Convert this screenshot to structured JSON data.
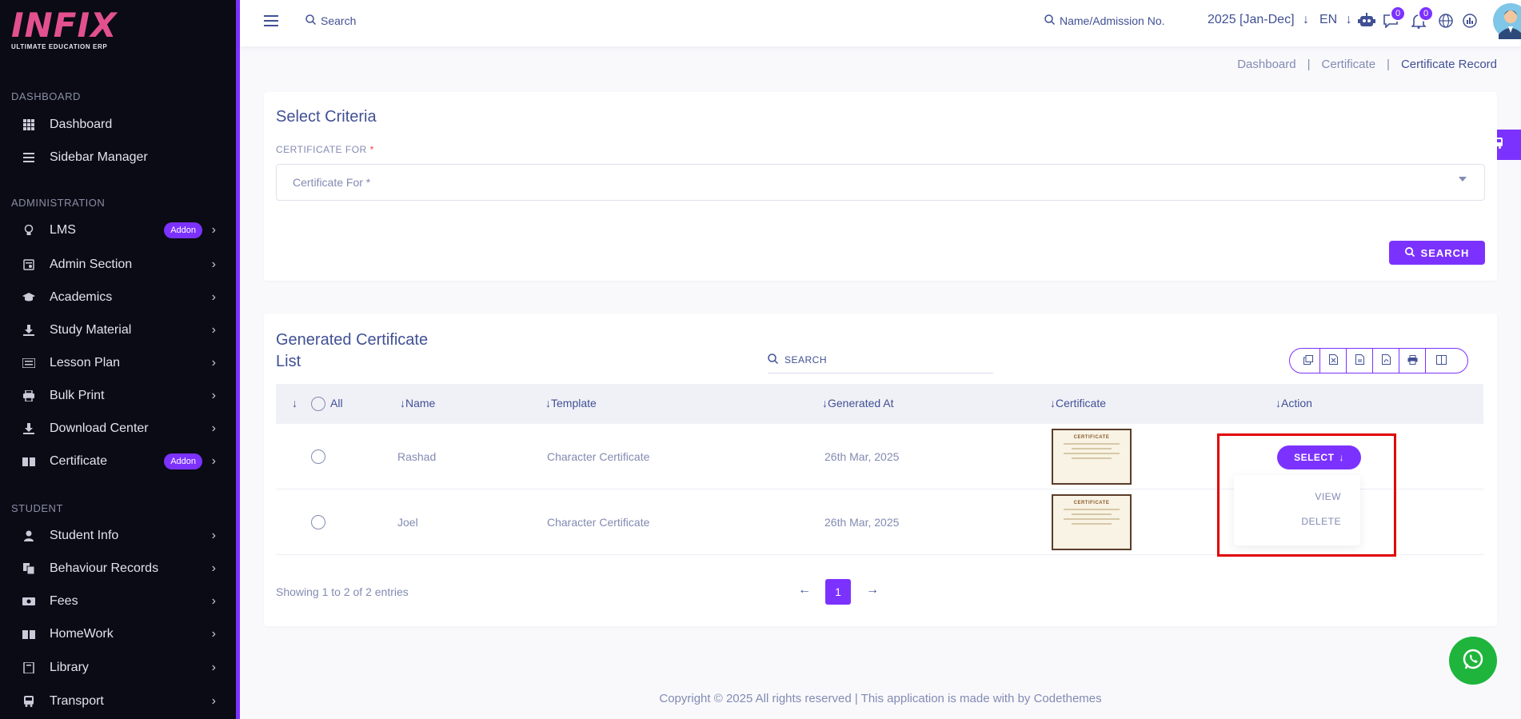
{
  "app": {
    "logo_text": "INFIX",
    "logo_sub": "ULTIMATE EDUCATION ERP"
  },
  "sidebar": {
    "sections": {
      "dashboard": "DASHBOARD",
      "administration": "ADMINISTRATION",
      "student": "STUDENT"
    },
    "items": [
      {
        "label": "Dashboard",
        "icon": "grid-icon"
      },
      {
        "label": "Sidebar Manager",
        "icon": "list-icon"
      },
      {
        "label": "LMS",
        "icon": "bulb-icon",
        "badge": "Addon"
      },
      {
        "label": "Admin Section",
        "icon": "admin-icon"
      },
      {
        "label": "Academics",
        "icon": "graduation-cap-icon"
      },
      {
        "label": "Study Material",
        "icon": "download-icon"
      },
      {
        "label": "Lesson Plan",
        "icon": "book-open-icon"
      },
      {
        "label": "Bulk Print",
        "icon": "printer-icon"
      },
      {
        "label": "Download Center",
        "icon": "download-icon"
      },
      {
        "label": "Certificate",
        "icon": "certificate-icon",
        "badge": "Addon"
      },
      {
        "label": "Student Info",
        "icon": "user-icon"
      },
      {
        "label": "Behaviour Records",
        "icon": "records-icon"
      },
      {
        "label": "Fees",
        "icon": "money-icon"
      },
      {
        "label": "HomeWork",
        "icon": "book-icon"
      },
      {
        "label": "Library",
        "icon": "library-icon"
      },
      {
        "label": "Transport",
        "icon": "bus-icon"
      }
    ]
  },
  "topbar": {
    "search_label": "Search",
    "name_search_label": "Name/Admission No.",
    "academic_year": "2025 [Jan-Dec]",
    "language": "EN",
    "messages_count": "0",
    "notifications_count": "0"
  },
  "breadcrumb": [
    "Dashboard",
    "Certificate",
    "Certificate Record"
  ],
  "criteria": {
    "title": "Select Criteria",
    "field_label": "CERTIFICATE FOR",
    "required_mark": "*",
    "select_placeholder": "Certificate For *",
    "search_button": "SEARCH"
  },
  "list": {
    "title_line1": "Generated Certificate",
    "title_line2": "List",
    "search_placeholder": "SEARCH",
    "columns": {
      "all": "All",
      "name": "Name",
      "template": "Template",
      "generated_at": "Generated At",
      "certificate": "Certificate",
      "action": "Action"
    },
    "rows": [
      {
        "name": "Rashad",
        "template": "Character Certificate",
        "generated_at": "26th Mar, 2025"
      },
      {
        "name": "Joel",
        "template": "Character Certificate",
        "generated_at": "26th Mar, 2025"
      }
    ],
    "thumb_title": "CERTIFICATE",
    "select_button": "SELECT",
    "dropdown": {
      "view": "VIEW",
      "delete": "DELETE"
    },
    "showing": "Showing 1 to 2 of 2 entries",
    "current_page": "1"
  },
  "footer": "Copyright © 2025 All rights reserved | This application is made with by Codethemes",
  "colors": {
    "accent": "#7c32ff",
    "sidebar_bg": "#0a0b14",
    "highlight": "#e10000",
    "whatsapp": "#1fb53d"
  }
}
